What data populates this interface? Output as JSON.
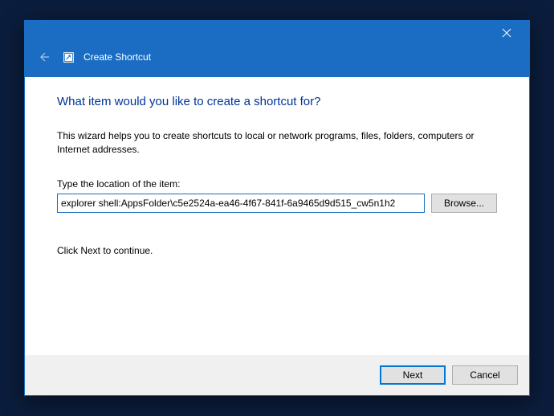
{
  "window": {
    "title": "Create Shortcut"
  },
  "content": {
    "heading": "What item would you like to create a shortcut for?",
    "description": "This wizard helps you to create shortcuts to local or network programs, files, folders, computers or Internet addresses.",
    "location_label": "Type the location of the item:",
    "location_value": "explorer shell:AppsFolder\\c5e2524a-ea46-4f67-841f-6a9465d9d515_cw5n1h2",
    "browse_label": "Browse...",
    "continue_text": "Click Next to continue."
  },
  "footer": {
    "next_label": "Next",
    "cancel_label": "Cancel"
  }
}
